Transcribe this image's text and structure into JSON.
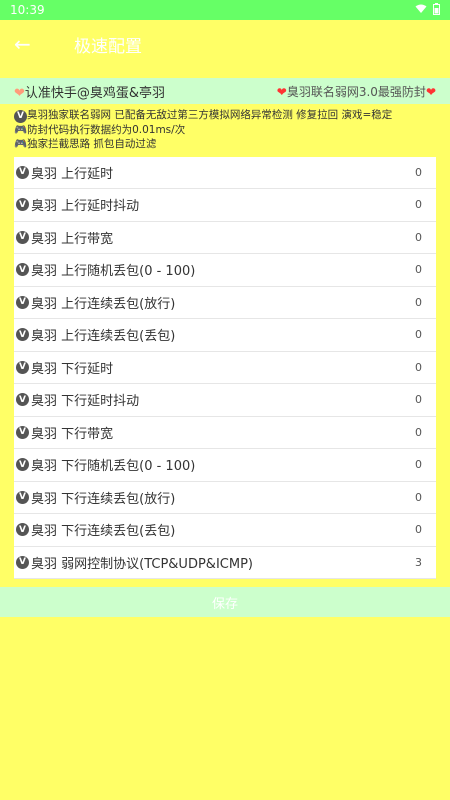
{
  "statusbar": {
    "time": "10:39"
  },
  "appbar": {
    "title": "极速配置"
  },
  "banner": {
    "left": "认准快手@臭鸡蛋&亭羽",
    "right": "臭羽联名弱网3.0最强防封"
  },
  "notes": [
    "臭羽独家联名弱网 已配备无敌过第三方模拟网络异常检测 修复拉回 演戏=稳定",
    "防封代码执行数据约为0.01ms/次",
    "独家拦截思路 抓包自动过滤"
  ],
  "rows": [
    {
      "label": "臭羽 上行延时",
      "value": "0"
    },
    {
      "label": "臭羽 上行延时抖动",
      "value": "0"
    },
    {
      "label": "臭羽 上行带宽",
      "value": "0"
    },
    {
      "label": "臭羽 上行随机丢包(0 - 100)",
      "value": "0"
    },
    {
      "label": "臭羽 上行连续丢包(放行)",
      "value": "0"
    },
    {
      "label": "臭羽 上行连续丢包(丢包)",
      "value": "0"
    },
    {
      "label": "臭羽 下行延时",
      "value": "0"
    },
    {
      "label": "臭羽 下行延时抖动",
      "value": "0"
    },
    {
      "label": "臭羽 下行带宽",
      "value": "0"
    },
    {
      "label": "臭羽 下行随机丢包(0 - 100)",
      "value": "0"
    },
    {
      "label": "臭羽 下行连续丢包(放行)",
      "value": "0"
    },
    {
      "label": "臭羽 下行连续丢包(丢包)",
      "value": "0"
    },
    {
      "label": "臭羽 弱网控制协议(TCP&UDP&ICMP)",
      "value": "3"
    }
  ],
  "save_label": "保存"
}
